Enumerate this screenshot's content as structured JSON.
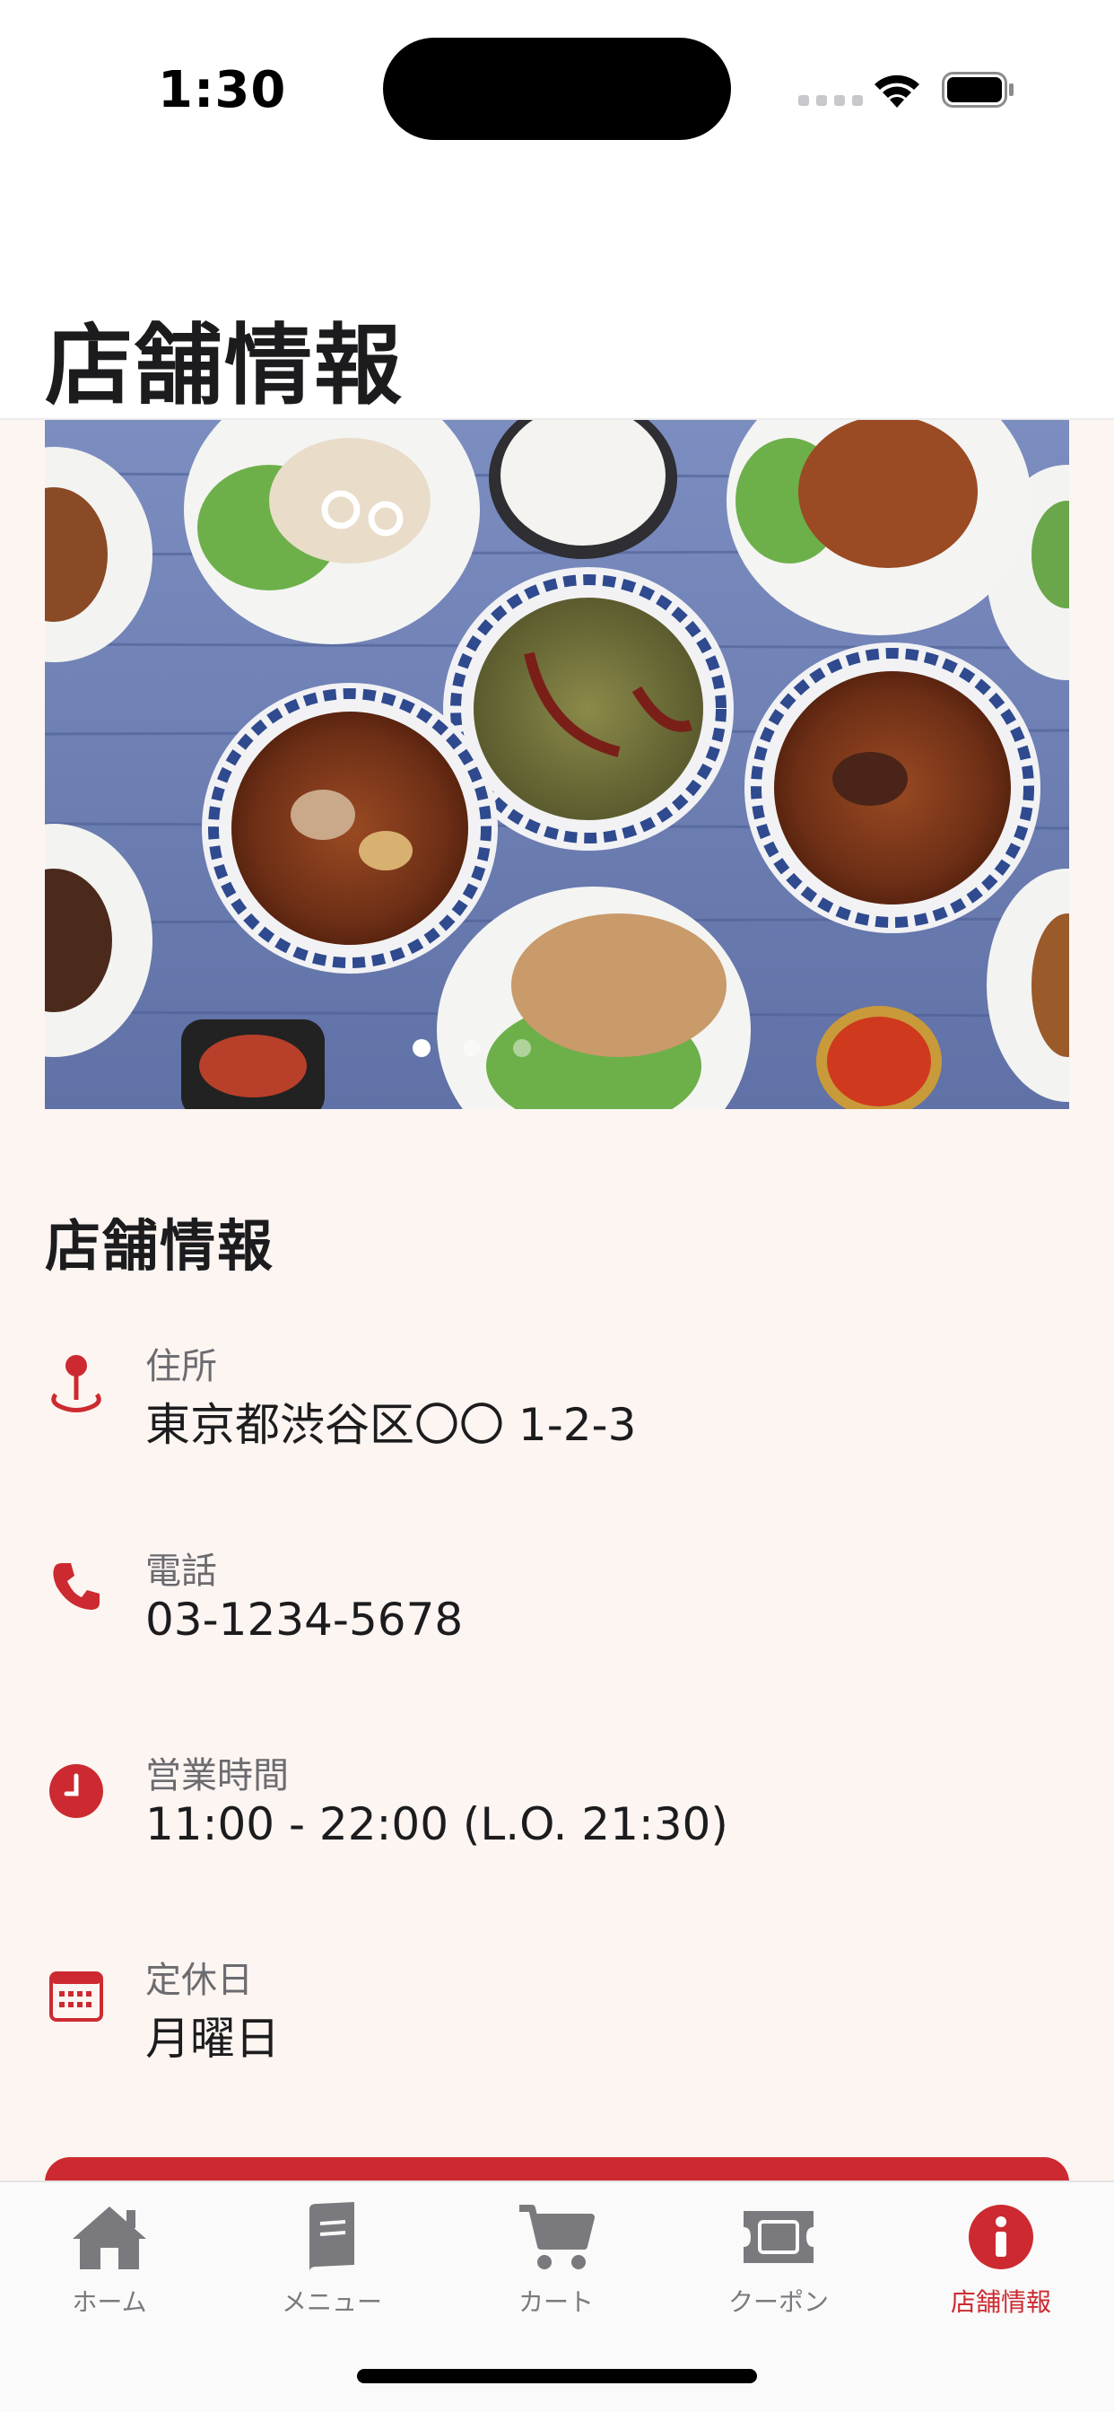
{
  "status_bar": {
    "time": "1:30"
  },
  "header": {
    "title": "店舗情報"
  },
  "hero": {
    "page_count": 3,
    "active_page": 1
  },
  "info": {
    "section_title": "店舗情報",
    "rows": [
      {
        "icon": "location-pin-icon",
        "label": "住所",
        "value": "東京都渋谷区〇〇 1-2-3"
      },
      {
        "icon": "phone-icon",
        "label": "電話",
        "value": "03-1234-5678"
      },
      {
        "icon": "clock-icon",
        "label": "営業時間",
        "value": "11:00 - 22:00 (L.O. 21:30)"
      },
      {
        "icon": "calendar-icon",
        "label": "定休日",
        "value": "月曜日"
      }
    ]
  },
  "tabs": [
    {
      "label": "ホーム",
      "icon": "home-icon",
      "active": false
    },
    {
      "label": "メニュー",
      "icon": "menu-book-icon",
      "active": false
    },
    {
      "label": "カート",
      "icon": "cart-icon",
      "active": false
    },
    {
      "label": "クーポン",
      "icon": "coupon-ticket-icon",
      "active": false
    },
    {
      "label": "店舗情報",
      "icon": "info-icon",
      "active": true
    }
  ],
  "colors": {
    "accent": "#cc2a30",
    "background": "#fdf5f1",
    "inactive_tab": "#7a7a7e"
  }
}
